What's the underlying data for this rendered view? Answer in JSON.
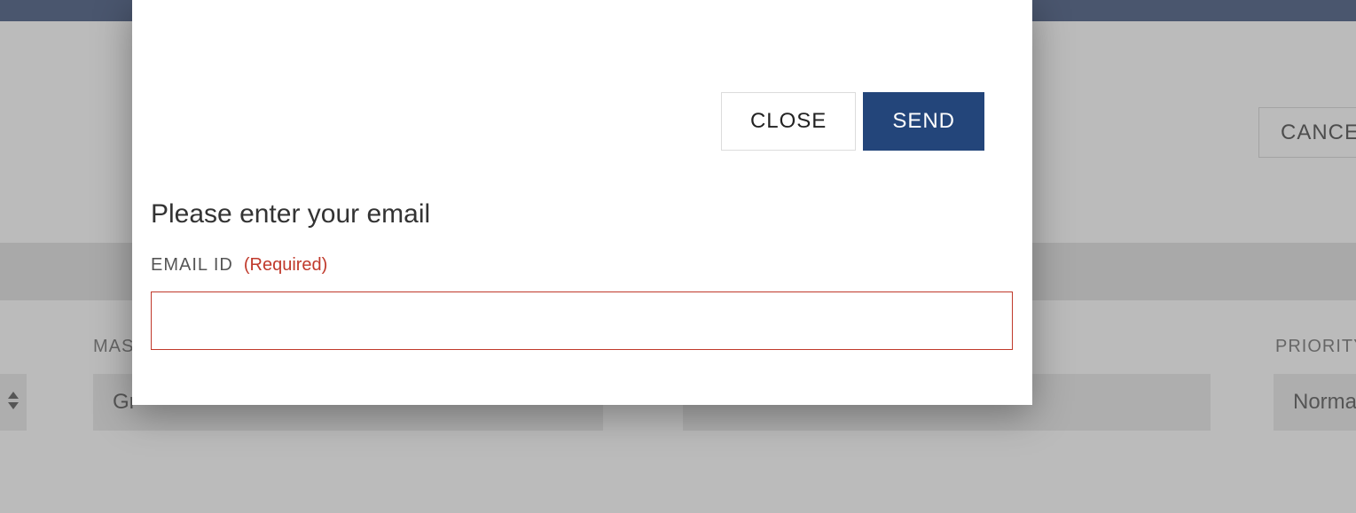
{
  "background": {
    "cancel_label": "CANCEL",
    "label_left": "MAS",
    "label_right": "PRIORITY",
    "select_left_value": "Gr",
    "select_right_value": "Norma"
  },
  "modal": {
    "close_label": "CLOSE",
    "send_label": "SEND",
    "title": "Please enter your email",
    "field_label": "EMAIL ID",
    "required_label": "(Required)",
    "email_value": ""
  }
}
